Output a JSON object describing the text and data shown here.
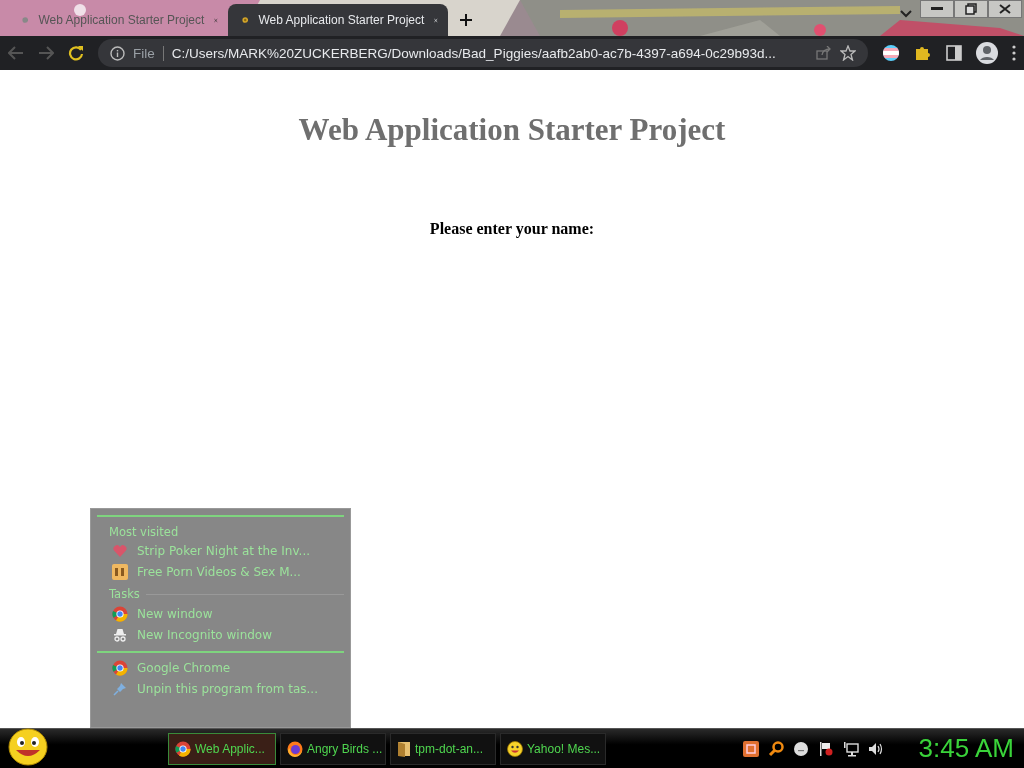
{
  "browser": {
    "tabs": [
      {
        "title": "Web Application Starter Project",
        "selected": false
      },
      {
        "title": "Web Application Starter Project",
        "selected": true
      }
    ],
    "address": {
      "scheme": "File",
      "url": "C:/Users/MARK%20ZUCKERBERG/Downloads/Bad_Piggies/aafb2ab0-ac7b-4397-a694-0c29b93d..."
    }
  },
  "page": {
    "heading": "Web Application Starter Project",
    "prompt": "Please enter your name:"
  },
  "jump_list": {
    "sections": [
      {
        "title": "Most visited",
        "items": [
          "Strip Poker Night at the Inv...",
          "Free Porn Videos & Sex M..."
        ]
      },
      {
        "title": "Tasks",
        "items": [
          "New window",
          "New Incognito window"
        ]
      }
    ],
    "pinned": [
      "Google Chrome",
      "Unpin this program from tas..."
    ]
  },
  "taskbar": {
    "buttons": [
      {
        "label": "Web Applic...",
        "selected": true
      },
      {
        "label": "Angry Birds ...",
        "selected": false
      },
      {
        "label": "tpm-dot-an...",
        "selected": false
      },
      {
        "label": "Yahoo! Mes...",
        "selected": false
      }
    ],
    "clock": "3:45 AM"
  }
}
